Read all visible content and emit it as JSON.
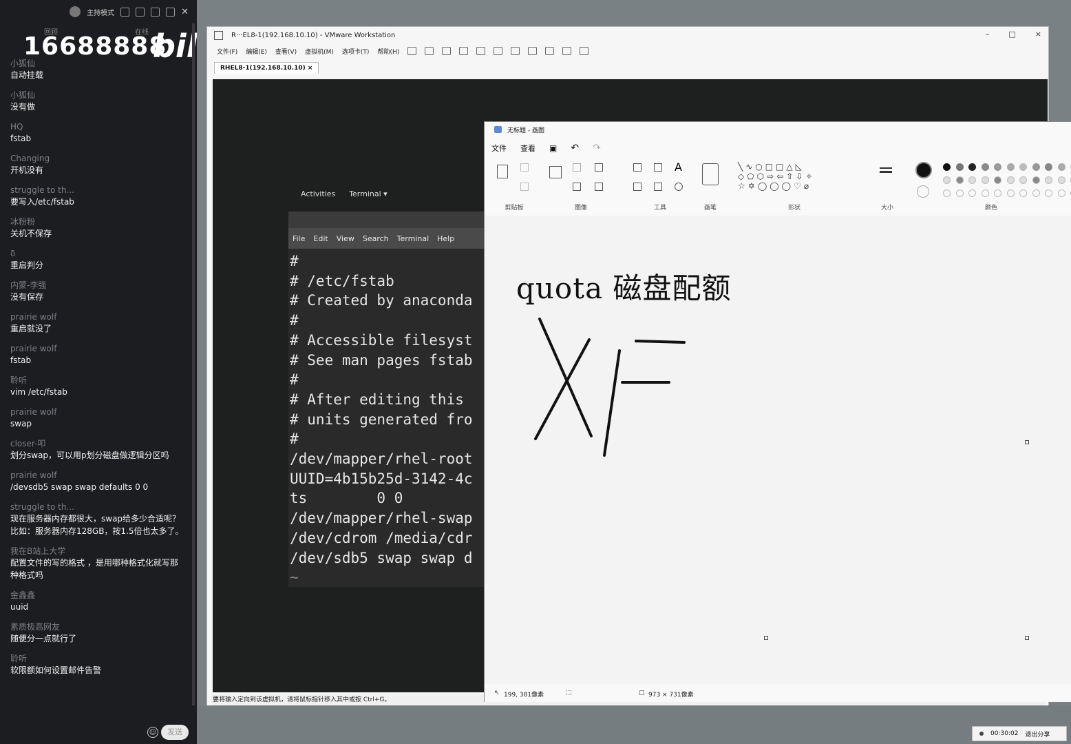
{
  "chat": {
    "top_mode": "主持模式",
    "tabs": [
      "回顾",
      "在线"
    ],
    "counter": "16688888",
    "logo": "bili",
    "messages": [
      {
        "user": "小狐仙",
        "text": "自动挂载"
      },
      {
        "user": "小狐仙",
        "text": "没有做"
      },
      {
        "user": "HQ",
        "text": "fstab"
      },
      {
        "user": "Changing",
        "text": "开机没有"
      },
      {
        "user": "struggle to th...",
        "text": "要写入/etc/fstab"
      },
      {
        "user": "冰粉粉",
        "text": "关机不保存"
      },
      {
        "user": "δ",
        "text": "重启判分"
      },
      {
        "user": "内蒙-李强",
        "text": "没有保存"
      },
      {
        "user": "prairie wolf",
        "text": "重启就没了"
      },
      {
        "user": "prairie wolf",
        "text": "fstab"
      },
      {
        "user": "聆听",
        "text": "vim /etc/fstab"
      },
      {
        "user": "prairie wolf",
        "text": "swap"
      },
      {
        "user": "closer-叩",
        "text": "划分swap，可以用p划分磁盘做逻辑分区吗"
      },
      {
        "user": "prairie wolf",
        "text": "/devsdb5 swap swap defaults 0 0"
      },
      {
        "user": "struggle to th...",
        "text": "现在服务器内存都很大，swap给多少合适呢？比如：服务器内存128GB，按1.5倍也太多了。"
      },
      {
        "user": "我在B站上大学",
        "text": "配置文件的写的格式 ，是用哪种格式化就写那种格式吗"
      },
      {
        "user": "金鑫鑫",
        "text": "uuid"
      },
      {
        "user": "素质极高网友",
        "text": "随便分一点就行了"
      },
      {
        "user": "聆听",
        "text": "软限额如何设置邮件告警"
      }
    ],
    "send_label": "发送"
  },
  "vmware": {
    "title": "R···EL8-1(192.168.10.10) - VMware Workstation",
    "menu": [
      "文件(F)",
      "编辑(E)",
      "查看(V)",
      "虚拟机(M)",
      "选项卡(T)",
      "帮助(H)"
    ],
    "tab": "RHEL8-1(192.168.10.10)",
    "status": "要将输入定向到该虚拟机，请将鼠标指针移入其中或按 Ctrl+G。",
    "win_controls": [
      "–",
      "□",
      "×"
    ]
  },
  "guest": {
    "activities": "Activities",
    "app": "Terminal ▾",
    "term_menu": [
      "File",
      "Edit",
      "View",
      "Search",
      "Terminal",
      "Help"
    ],
    "lines": [
      "#",
      "# /etc/fstab",
      "# Created by anaconda",
      "#",
      "# Accessible filesyst",
      "# See man pages fstab",
      "#",
      "# After editing this",
      "# units generated fro",
      "#",
      "/dev/mapper/rhel-root",
      "UUID=4b15b25d-3142-4c",
      "ts        0 0",
      "/dev/mapper/rhel-swap",
      "/dev/cdrom /media/cdr",
      "/dev/sdb5 swap swap d",
      "~"
    ]
  },
  "paint": {
    "title": "无标题 - 画图",
    "menu": [
      "文件",
      "查看"
    ],
    "groups": [
      "剪贴板",
      "图像",
      "工具",
      "画笔",
      "形状",
      "大小",
      "颜色"
    ],
    "canvas_text": "quota 磁盘配额",
    "status_pos": "199, 381像素",
    "status_size": "973 × 731像素",
    "colors": [
      "#111111",
      "#777777",
      "#222222",
      "#8a8a8a",
      "#9a9a9a",
      "#aaaaaa",
      "#bbbbbb",
      "#999999",
      "#888888",
      "#aaaaaa",
      "#cccccc"
    ]
  },
  "recording": {
    "time": "00:30:02",
    "exit": "退出分享"
  }
}
